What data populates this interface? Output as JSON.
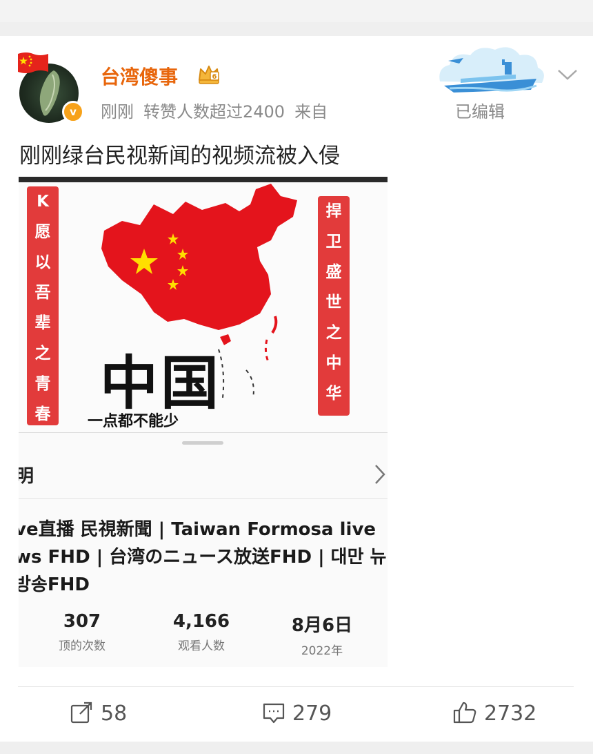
{
  "colors": {
    "username": "#e8660c",
    "banner_red": "#e23b3b",
    "map_red": "#e4141c",
    "badge": "#f7a21a"
  },
  "post": {
    "username": "台湾傻事",
    "meta": {
      "time": "刚刚",
      "stat": "转赞人数超过2400",
      "source": "来自"
    },
    "edited": "已编辑",
    "text": "刚刚绿台民视新闻的视频流被入侵"
  },
  "image": {
    "banner_left": [
      "K",
      "愿",
      "以",
      "吾",
      "辈",
      "之",
      "青",
      "春"
    ],
    "banner_right": [
      "捍",
      "卫",
      "盛",
      "世",
      "之",
      "中",
      "华"
    ],
    "big_text": "中国",
    "slogan": "一点都不能少",
    "desc_label": "明",
    "live_title": [
      "ve直播 民視新聞 | Taiwan Formosa live",
      "ws FHD | 台湾のニュース放送FHD | 대만 뉴",
      "방송FHD"
    ],
    "stats": [
      {
        "value": "307",
        "label": "顶的次数"
      },
      {
        "value": "4,166",
        "label": "观看人数"
      },
      {
        "value": "8月6日",
        "label": "2022年"
      }
    ]
  },
  "actions": {
    "repost": "58",
    "comment": "279",
    "like": "2732"
  },
  "icons": [
    "china-flag-icon",
    "vip-crown-icon",
    "verified-badge-icon",
    "chevron-down-icon",
    "chevron-right-icon",
    "repost-icon",
    "comment-icon",
    "like-icon"
  ]
}
